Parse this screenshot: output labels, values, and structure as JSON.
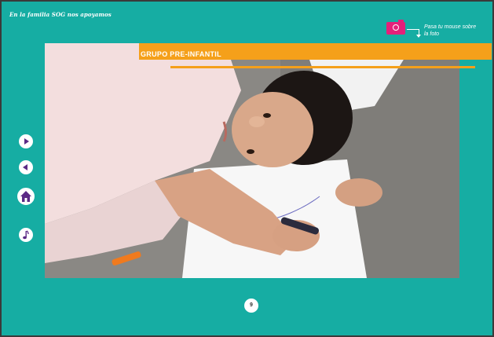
{
  "header": {
    "title": "En la familia SOG nos apoyamos"
  },
  "photo_hint": {
    "text": "Pasa tu mouse sobre la foto",
    "icon": "camera-icon"
  },
  "section": {
    "banner_title": "GRUPO PRE-INFANTIL"
  },
  "nav": {
    "buttons": [
      {
        "icon": "play-right-icon"
      },
      {
        "icon": "play-left-icon"
      },
      {
        "icon": "home-icon"
      },
      {
        "icon": "music-note-icon"
      }
    ]
  },
  "footer": {
    "page_number": "9"
  },
  "colors": {
    "background": "#16ada3",
    "accent_orange": "#f5a01a",
    "camera_pink": "#e4207a",
    "nav_purple": "#5b2a86"
  }
}
